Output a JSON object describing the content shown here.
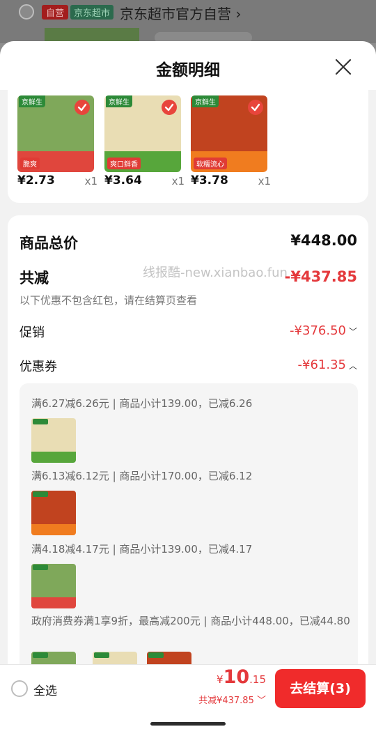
{
  "background": {
    "self_op_badge": "自营",
    "supermarket_badge": "京东超市",
    "store_name": "京东超市官方自营",
    "store_chevron": "›"
  },
  "sheet": {
    "title": "金额明细",
    "close_icon": "close-icon"
  },
  "products": [
    {
      "brand": "京鲜生",
      "tag": "脆爽",
      "price": "¥2.73",
      "qty": "x1",
      "top_color": "#7fa85a",
      "band_color": "#e0463d",
      "checked": true
    },
    {
      "brand": "京鲜生",
      "tag": "爽口鲜香",
      "price": "¥3.64",
      "qty": "x1",
      "top_color": "#e9ddb4",
      "band_color": "#57a63b",
      "checked": true
    },
    {
      "brand": "京鲜生",
      "tag": "软糯流心",
      "price": "¥3.78",
      "qty": "x1",
      "top_color": "#c1431f",
      "band_color": "#f07c1f",
      "checked": true
    }
  ],
  "summary": {
    "total_label": "商品总价",
    "total_value": "¥448.00",
    "reduce_label": "共减",
    "reduce_value": "-¥437.85",
    "note": "以下优惠不包含红包，请在结算页查看",
    "watermark": "线报酷-new.xianbao.fun",
    "promo_label": "促销",
    "promo_value": "-¥376.50",
    "promo_chevron": "﹀",
    "coupon_label": "优惠券",
    "coupon_value": "-¥61.35",
    "coupon_chevron": "︿"
  },
  "coupons": [
    {
      "text": "满6.27减6.26元 | 商品小计139.00，已减6.26",
      "thumb_top": "#e9ddb4",
      "thumb_band": "#57a63b"
    },
    {
      "text": "满6.13减6.12元 | 商品小计170.00，已减6.12",
      "thumb_top": "#c1431f",
      "thumb_band": "#f07c1f"
    },
    {
      "text": "满4.18减4.17元 | 商品小计139.00，已减4.17",
      "thumb_top": "#7fa85a",
      "thumb_band": "#e0463d"
    },
    {
      "text": "政府消费券满1享9折，最高减200元 | 商品小计448.00，已减44.80"
    }
  ],
  "bottom_bar": {
    "select_all": "全选",
    "pay_currency": "¥",
    "pay_integer": "10",
    "pay_decimal": ".15",
    "reduce_summary": "共减¥437.85",
    "reduce_chevron": "﹀",
    "checkout_label": "去结算(3)"
  },
  "colors": {
    "accent_red": "#e4393c",
    "checkout_red": "#f02b2b"
  }
}
